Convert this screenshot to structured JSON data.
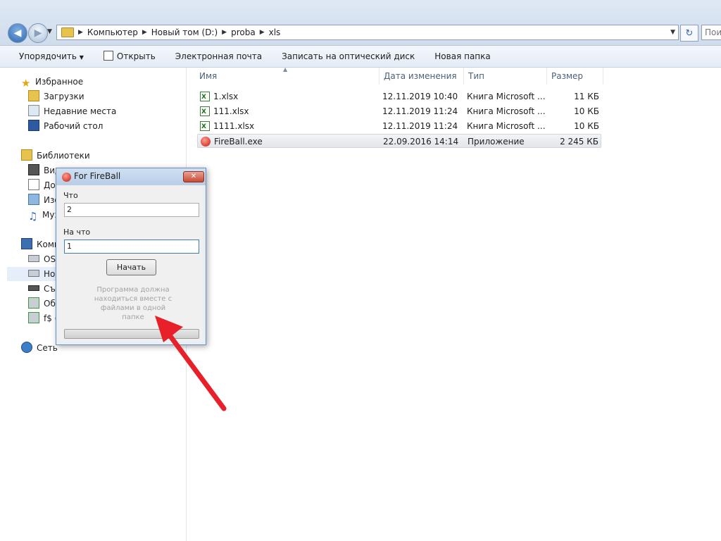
{
  "address": {
    "crumbs": [
      "Компьютер",
      "Новый том (D:)",
      "proba",
      "xls"
    ],
    "search_placeholder": "Поиск: xls"
  },
  "toolbar": {
    "organize": "Упорядочить",
    "open": "Открыть",
    "email": "Электронная почта",
    "burn": "Записать на оптический диск",
    "new_folder": "Новая папка"
  },
  "nav": {
    "favorites": "Избранное",
    "downloads": "Загрузки",
    "recent": "Недавние места",
    "desktop": "Рабочий стол",
    "libraries": "Библиотеки",
    "video": "Видео",
    "documents": "Документы",
    "images": "Изображения",
    "music": "Музыка",
    "computer": "Компьютер",
    "drive_os": "OS (C:)",
    "drive_new": "Новый том (D:)",
    "removable": "Съемный диск",
    "net_drive1": "Общие",
    "net_drive2": "f$ (\\\\",
    "network": "Сеть"
  },
  "columns": {
    "name": "Имя",
    "date": "Дата изменения",
    "type": "Тип",
    "size": "Размер"
  },
  "files": [
    {
      "name": "1.xlsx",
      "date": "12.11.2019 10:40",
      "type": "Книга Microsoft ...",
      "size": "11 КБ"
    },
    {
      "name": "111.xlsx",
      "date": "12.11.2019 11:24",
      "type": "Книга Microsoft ...",
      "size": "10 КБ"
    },
    {
      "name": "1111.xlsx",
      "date": "12.11.2019 11:24",
      "type": "Книга Microsoft ...",
      "size": "10 КБ"
    },
    {
      "name": "FireBall.exe",
      "date": "22.09.2016 14:14",
      "type": "Приложение",
      "size": "2 245 КБ"
    }
  ],
  "dialog": {
    "title": "For FireBall",
    "close": "✕",
    "what_label": "Что",
    "what_value": "2",
    "to_label": "На что",
    "to_value": "1",
    "start_button": "Начать",
    "note_line1": "Программа должна",
    "note_line2": "находиться вместе с",
    "note_line3": "файлами в одной",
    "note_line4": "папке",
    "progress": 0
  },
  "colors": {
    "arrow": "#e8202a",
    "accent": "#2f67ad"
  }
}
